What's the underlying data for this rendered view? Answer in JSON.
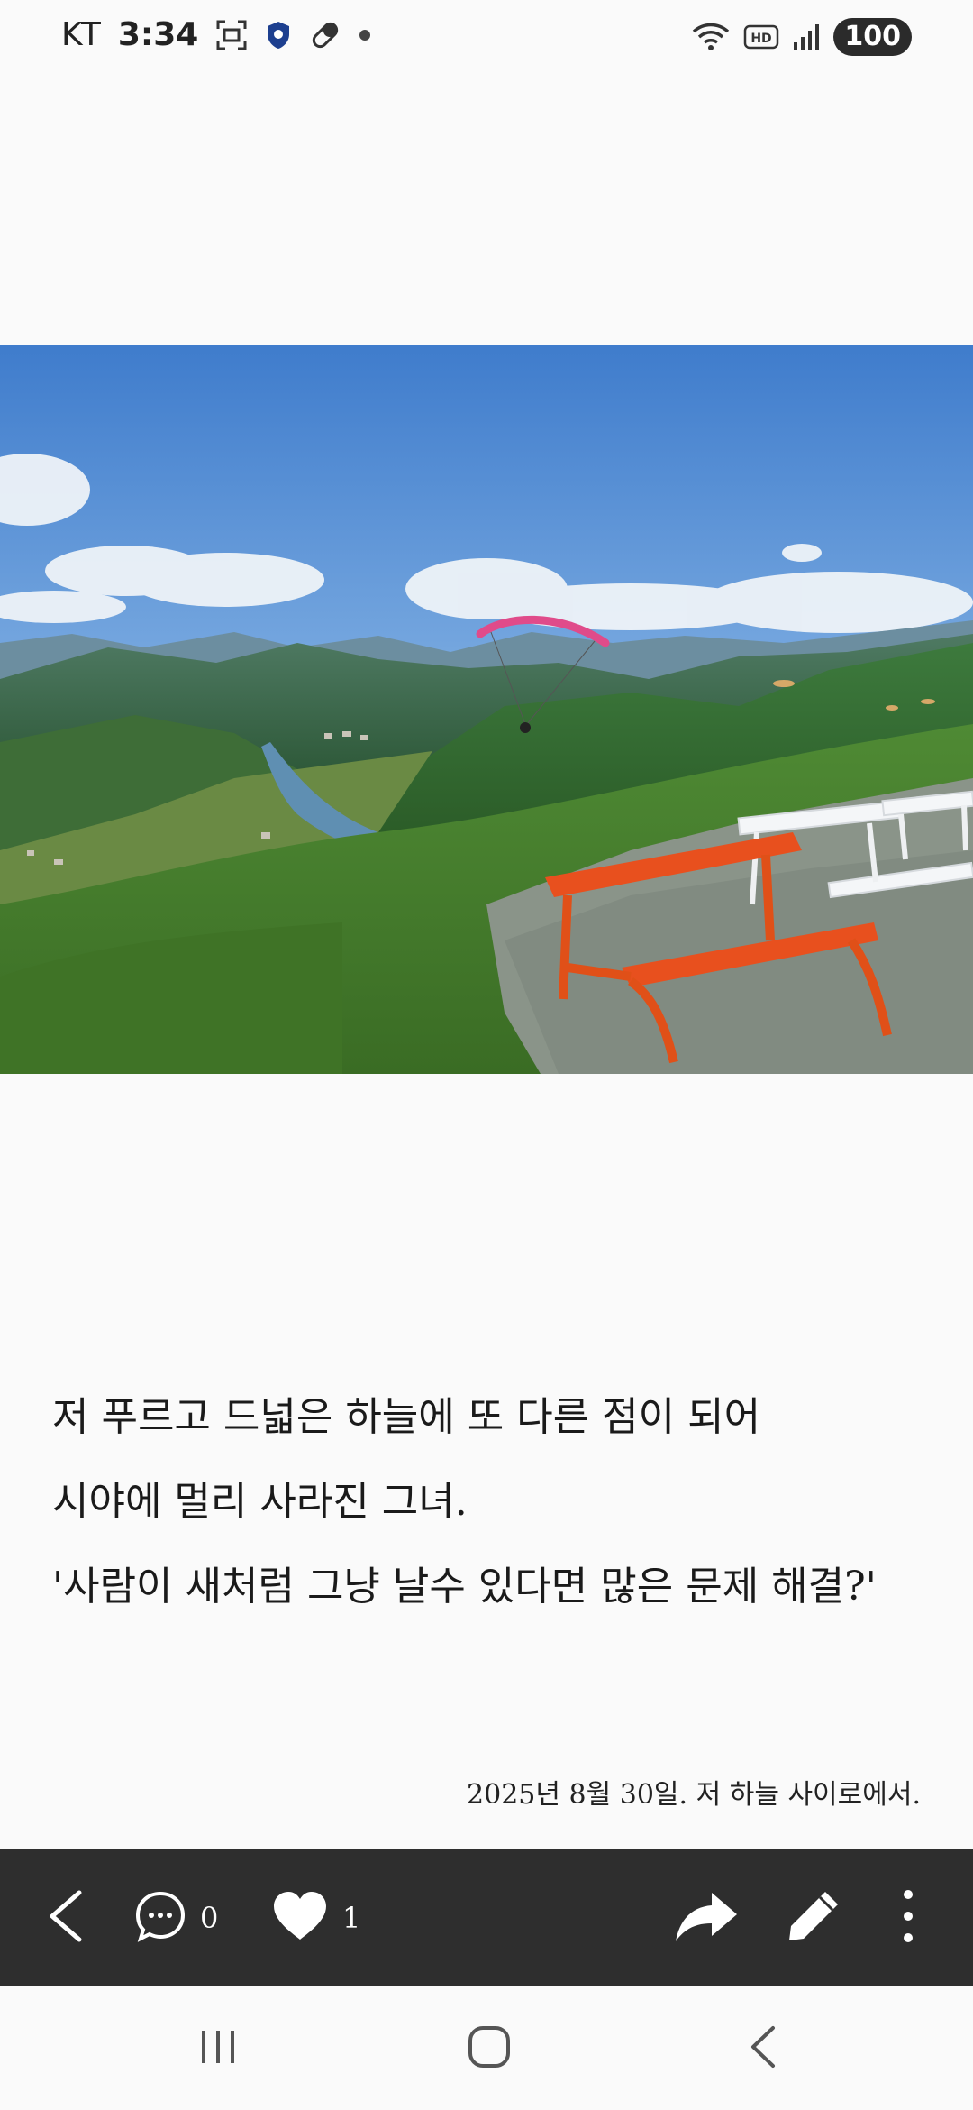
{
  "status_bar": {
    "carrier": "KT",
    "time": "3:34",
    "battery": "100",
    "icons": [
      "screenshot-icon",
      "shield-icon",
      "pill-icon",
      "dot-icon",
      "wifi-icon",
      "hd-icon",
      "signal-icon"
    ]
  },
  "photo": {
    "subject": "mountain-landscape-paraglider-photo"
  },
  "poem": {
    "lines": [
      "저 푸르고 드넓은 하늘에 또 다른 점이 되어",
      "시야에 멀리 사라진 그녀.",
      "'사람이 새처럼 그냥 날수 있다면 많은 문제 해결?'"
    ]
  },
  "caption": "2025년 8월 30일. 저 하늘 사이로에서.",
  "action_bar": {
    "comment_count": "0",
    "like_count": "1",
    "icons": [
      "back-icon",
      "comment-icon",
      "heart-icon",
      "share-icon",
      "edit-icon",
      "more-icon"
    ]
  },
  "nav_bar": {
    "icons": [
      "recents-icon",
      "home-icon",
      "back-icon"
    ]
  },
  "colors": {
    "toolbar_bg": "#2e2e2e",
    "page_bg": "#fafafa",
    "sky": "#4a86d4",
    "bench": "#e8501e"
  }
}
